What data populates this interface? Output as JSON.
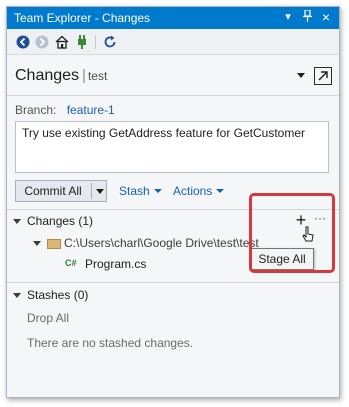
{
  "window": {
    "title": "Team Explorer - Changes",
    "controls": {
      "dropdown": "▾",
      "pin": "ᵠ",
      "close": "×"
    }
  },
  "toolbar": {
    "icons": [
      "back-icon",
      "forward-icon",
      "home-icon",
      "connect-icon",
      "refresh-icon"
    ]
  },
  "page": {
    "title": "Changes",
    "separator": "|",
    "subtitle": "test"
  },
  "branch": {
    "label": "Branch:",
    "name": "feature-1"
  },
  "commit_message": "Try use existing GetAddress feature for GetCustomer",
  "actions": {
    "commit_label": "Commit All",
    "stash_label": "Stash",
    "actions_label": "Actions"
  },
  "changes_section": {
    "header": "Changes (1)",
    "more": "···",
    "folder_path": "C:\\Users\\charl\\Google Drive\\test\\test",
    "file_badge": "C#",
    "file_name": "Program.cs",
    "tooltip": "Stage All"
  },
  "stashes_section": {
    "header": "Stashes (0)",
    "drop_all": "Drop All",
    "empty_message": "There are no stashed changes."
  },
  "colors": {
    "titlebar": "#007acc",
    "link": "#1a5fb4",
    "highlight": "#d9363e"
  }
}
